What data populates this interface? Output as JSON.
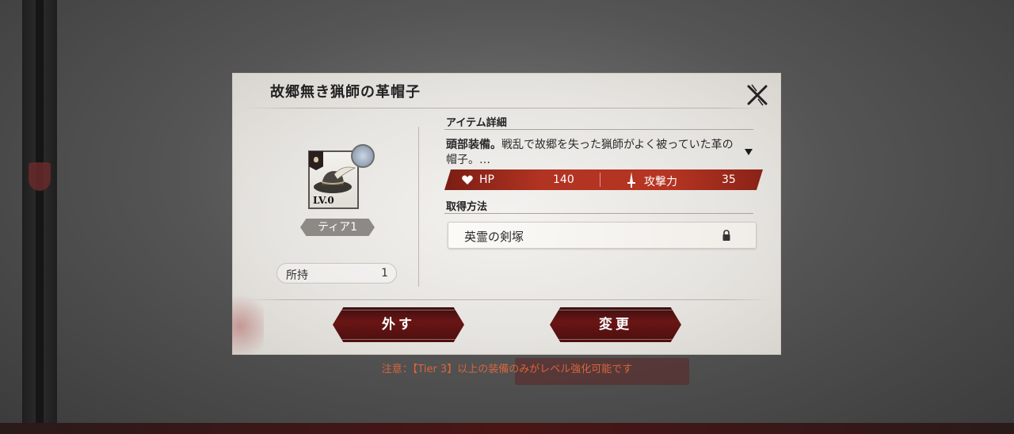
{
  "dialog": {
    "title": "故郷無き猟師の革帽子",
    "close_icon": "close-x-icon"
  },
  "item": {
    "level": "LV.0",
    "tier": "ティア1",
    "owned_label": "所持",
    "owned_count": "1"
  },
  "details": {
    "header": "アイテム詳細",
    "desc_bold": "頭部装備。",
    "desc_text": "戦乱で故郷を失った猟師がよく被っていた革の帽子。…"
  },
  "stats": [
    {
      "icon": "heart-icon",
      "label": "HP",
      "value": "140"
    },
    {
      "icon": "sword-icon",
      "label": "攻撃力",
      "value": "35"
    }
  ],
  "acquire": {
    "header": "取得方法",
    "source": "英霊の剣塚",
    "source_icon": "lock-icon"
  },
  "buttons": {
    "remove": "外す",
    "change": "変更"
  },
  "notice": "注意：【Tier 3】以上の装備のみがレベル強化可能です",
  "colors": {
    "accent_red": "#b13322",
    "button_red": "#6b1515",
    "notice_orange": "#d9643c"
  }
}
